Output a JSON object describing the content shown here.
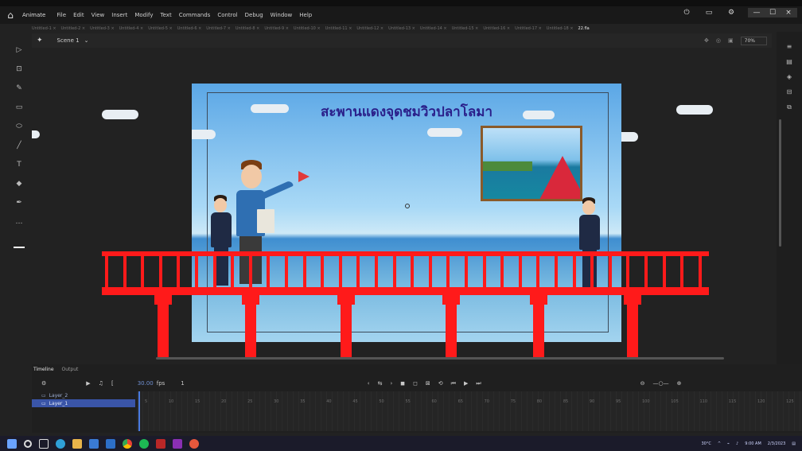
{
  "app": {
    "name": "Animate"
  },
  "menu": {
    "items": [
      "File",
      "Edit",
      "View",
      "Insert",
      "Modify",
      "Text",
      "Commands",
      "Control",
      "Debug",
      "Window",
      "Help"
    ]
  },
  "doc_tabs": {
    "items": [
      "Untitled-1",
      "Untitled-2",
      "Untitled-3",
      "Untitled-4",
      "Untitled-5",
      "Untitled-6",
      "Untitled-7",
      "Untitled-8",
      "Untitled-9",
      "Untitled-10",
      "Untitled-11",
      "Untitled-12",
      "Untitled-13",
      "Untitled-14",
      "Untitled-15",
      "Untitled-16",
      "Untitled-17",
      "Untitled-18"
    ],
    "active": "22.fla"
  },
  "scene": {
    "name": "Scene 1",
    "zoom": "70%"
  },
  "stage": {
    "title": "สะพานแดงจุดชมวิวปลาโลมา"
  },
  "timeline": {
    "tab_label": "Timeline",
    "tab2_label": "Output",
    "fps": "30.00",
    "frame": "1",
    "layers": [
      {
        "name": "Layer_2",
        "selected": false
      },
      {
        "name": "Layer_1",
        "selected": true
      }
    ],
    "frame_numbers": [
      "5",
      "10",
      "15",
      "20",
      "25",
      "30",
      "35",
      "40",
      "45",
      "50",
      "55",
      "60",
      "65",
      "70",
      "75",
      "80",
      "85",
      "90",
      "95",
      "100",
      "105",
      "110",
      "115",
      "120",
      "125"
    ]
  },
  "taskbar": {
    "weather": "30°C",
    "time": "9:00 AM",
    "date": "2/3/2023"
  },
  "colors": {
    "accent": "#2a6cd8",
    "bridge": "#ff1a1a",
    "title": "#2a1f8a"
  }
}
